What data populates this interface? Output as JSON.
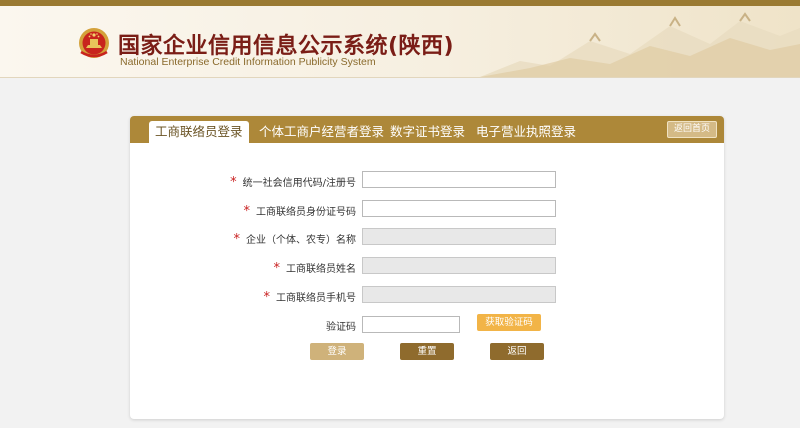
{
  "header": {
    "title_cn": "国家企业信用信息公示系统(陕西)",
    "title_en": "National Enterprise Credit Information Publicity System"
  },
  "tabs": [
    {
      "label": "工商联络员登录",
      "active": true
    },
    {
      "label": "个体工商户经营者登录",
      "active": false
    },
    {
      "label": "数字证书登录",
      "active": false
    },
    {
      "label": "电子营业执照登录",
      "active": false
    }
  ],
  "home_button": "返回首页",
  "form": {
    "fields": [
      {
        "label": "统一社会信用代码/注册号",
        "required": true,
        "value": "",
        "disabled": false
      },
      {
        "label": "工商联络员身份证号码",
        "required": true,
        "value": "",
        "disabled": false
      },
      {
        "label": "企业（个体、农专）名称",
        "required": true,
        "value": "",
        "disabled": true
      },
      {
        "label": "工商联络员姓名",
        "required": true,
        "value": "",
        "disabled": true
      },
      {
        "label": "工商联络员手机号",
        "required": true,
        "value": "",
        "disabled": true
      }
    ],
    "captcha_label": "验证码",
    "captcha_value": "",
    "captcha_button": "获取验证码",
    "required_mark": "*"
  },
  "buttons": {
    "login": "登录",
    "reset": "重置",
    "back": "返回"
  },
  "colors": {
    "accent": "#ad8839",
    "title": "#7a1d16",
    "required": "#c81e1e",
    "captcha_button": "#f2b447"
  },
  "icons": {
    "emblem": "national-emblem-icon"
  }
}
